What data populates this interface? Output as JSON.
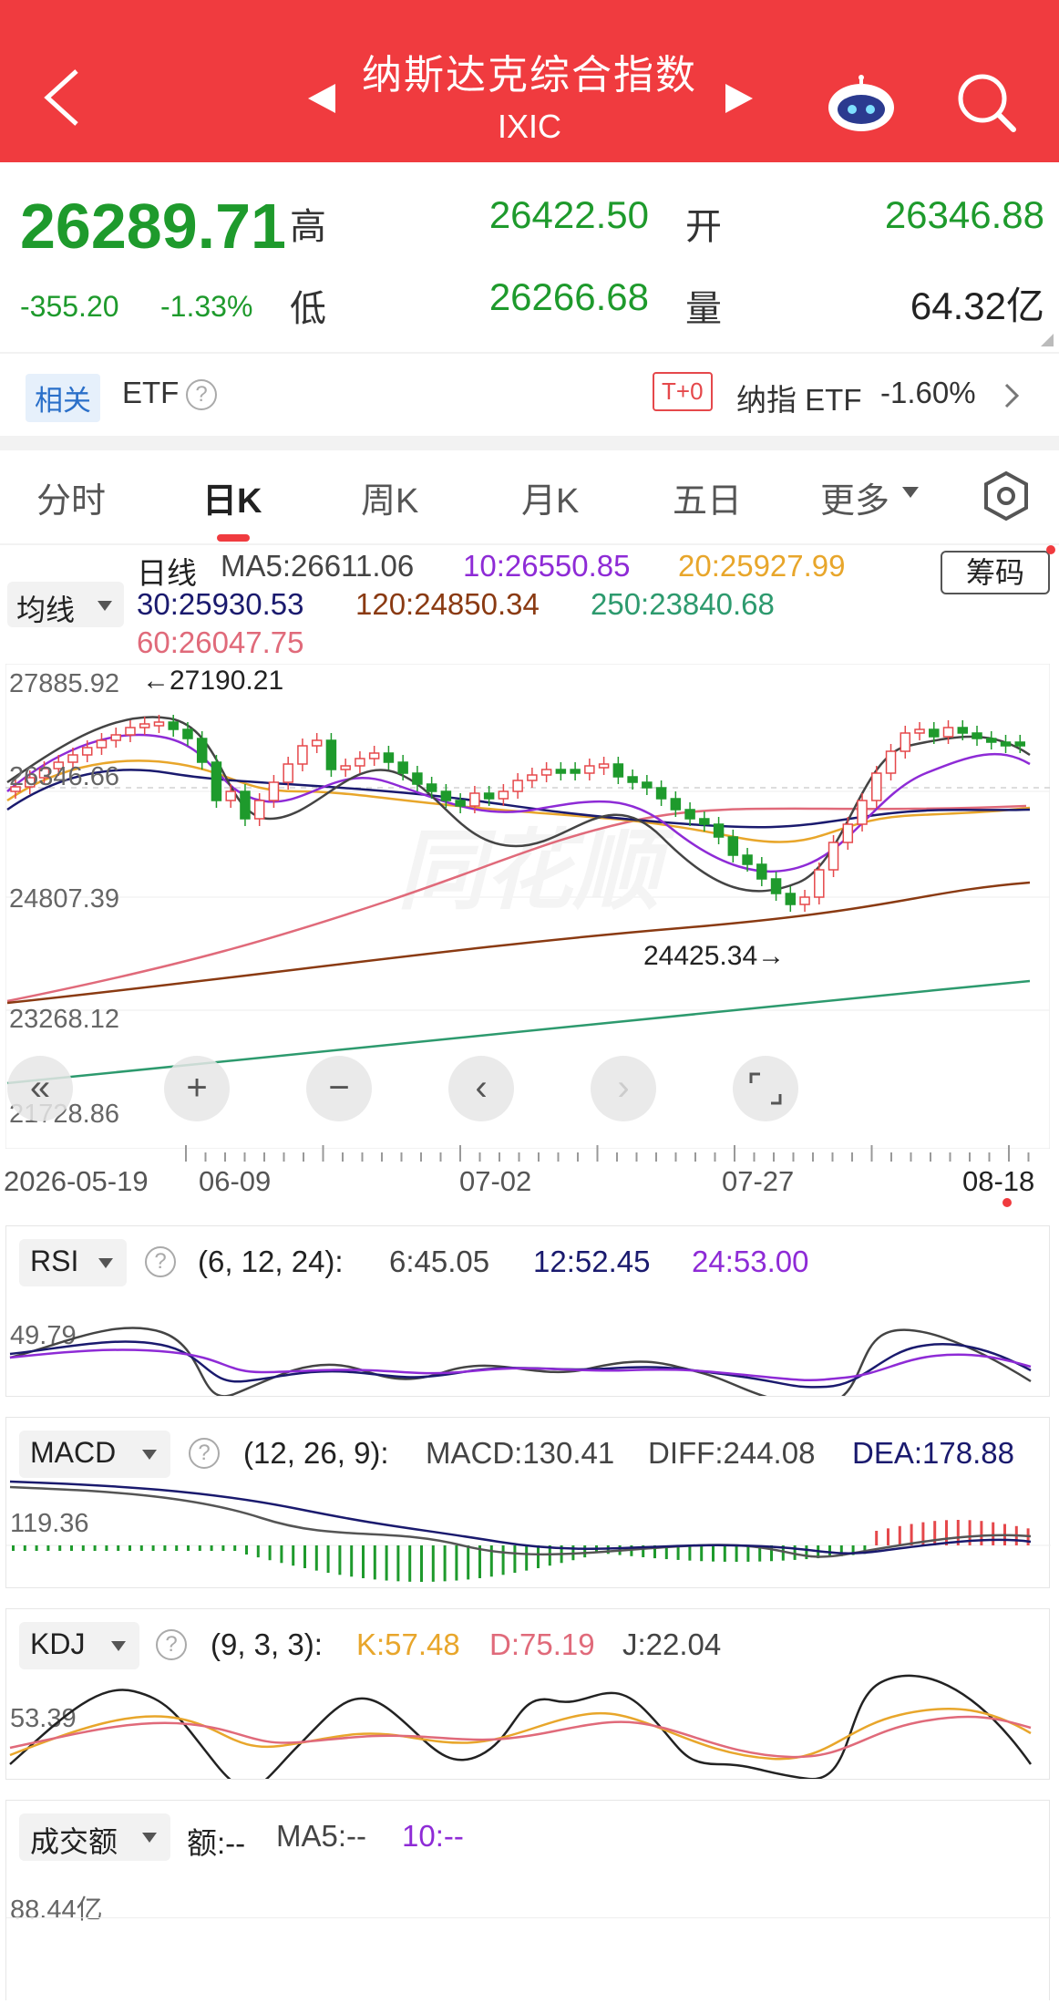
{
  "header": {
    "title": "纳斯达克综合指数",
    "code": "IXIC"
  },
  "quote": {
    "price": "26289.71",
    "change": "-355.20",
    "change_pct": "-1.33%",
    "high_label": "高",
    "high": "26422.50",
    "open_label": "开",
    "open": "26346.88",
    "low_label": "低",
    "low": "26266.68",
    "volume_label": "量",
    "volume": "64.32亿"
  },
  "etf": {
    "related_tag": "相关",
    "etf_label": "ETF",
    "t0_tag": "T+0",
    "name": "纳指 ETF",
    "change": "-1.60%"
  },
  "tabs": [
    "分时",
    "日K",
    "周K",
    "月K",
    "五日",
    "更多"
  ],
  "ma_legend": {
    "period": "日线",
    "ma5": "MA5:26611.06",
    "ma10": "10:26550.85",
    "ma20": "20:25927.99",
    "ma30": "30:25930.53",
    "ma120": "120:24850.34",
    "ma250": "250:23840.68",
    "ma60": "60:26047.75",
    "button": "均线",
    "chip": "筹码"
  },
  "kline": {
    "y_labels": [
      "27885.92",
      "26346.66",
      "24807.39",
      "23268.12",
      "21728.86"
    ],
    "high_marker": "←27190.21",
    "low_marker": "24425.34→",
    "dates": [
      "2026-05-19",
      "06-09",
      "07-02",
      "07-27",
      "08-18"
    ]
  },
  "rsi": {
    "name": "RSI",
    "params": "(6, 12, 24):",
    "v6": "6:45.05",
    "v12": "12:52.45",
    "v24": "24:53.00",
    "axis": "49.79"
  },
  "macd": {
    "name": "MACD",
    "params": "(12, 26, 9):",
    "macd": "MACD:130.41",
    "diff": "DIFF:244.08",
    "dea": "DEA:178.88",
    "axis": "119.36"
  },
  "kdj": {
    "name": "KDJ",
    "params": "(9, 3, 3):",
    "k": "K:57.48",
    "d": "D:75.19",
    "j": "J:22.04",
    "axis": "53.39"
  },
  "turnover": {
    "name": "成交额",
    "amount": "额:--",
    "ma5": "MA5:--",
    "ma10": "10:--",
    "axis": "88.44亿"
  },
  "colors": {
    "header_red": "#f03b3f",
    "down_green": "#1e9a2c",
    "up_red": "#e5484b",
    "ma5": "#444444",
    "ma10": "#8e2bd6",
    "ma20": "#e8a62b",
    "ma30": "#1a1a6e",
    "ma60": "#e06a7a",
    "ma120": "#8a3a12",
    "ma250": "#2d9a6e"
  }
}
